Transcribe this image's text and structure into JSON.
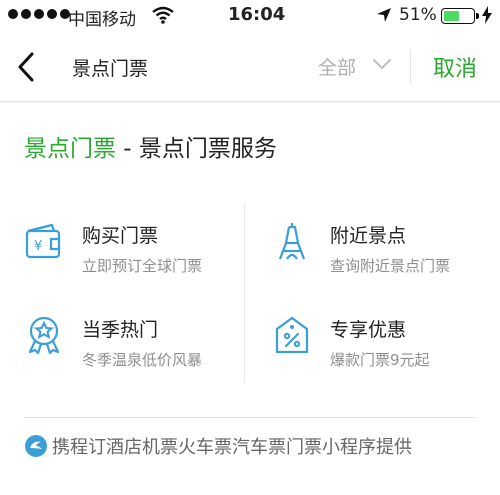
{
  "status_bar": {
    "carrier": "中国移动",
    "time": "16:04",
    "battery_percent": "51%",
    "battery_level": 0.51,
    "icons": [
      "signal-dots-icon",
      "wifi-icon",
      "location-arrow-icon",
      "battery-icon",
      "charging-bolt-icon"
    ]
  },
  "nav": {
    "back_icon": "chevron-left-icon",
    "title": "景点门票",
    "filter_label": "全部",
    "filter_icon": "chevron-down-icon",
    "cancel_label": "取消"
  },
  "section": {
    "title_green": "景点门票",
    "title_rest": " - 景点门票服务"
  },
  "services": [
    {
      "name": "购买门票",
      "desc": "立即预订全球门票",
      "icon": "wallet-yen-icon"
    },
    {
      "name": "附近景点",
      "desc": "查询附近景点门票",
      "icon": "eiffel-tower-icon"
    },
    {
      "name": "当季热门",
      "desc": "冬季温泉低价风暴",
      "icon": "medal-star-icon"
    },
    {
      "name": "专享优惠",
      "desc": "爆款门票9元起",
      "icon": "discount-tag-icon"
    }
  ],
  "footer": {
    "provider_text": "携程订酒店机票火车票汽车票门票小程序提供",
    "provider_icon": "ctrip-logo-icon"
  },
  "colors": {
    "accent": "#2aa830",
    "icon_blue": "#3a9fd8",
    "muted": "#8f8f8f"
  }
}
